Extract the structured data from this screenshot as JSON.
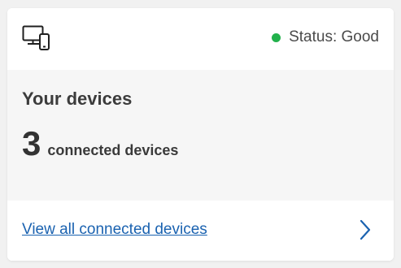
{
  "status": {
    "text": "Status: Good",
    "color": "#22b14c"
  },
  "devices": {
    "title": "Your devices",
    "count": "3",
    "count_label": "connected devices"
  },
  "footer": {
    "link_text": "View all connected devices"
  },
  "icons": {
    "header": "devices-icon",
    "footer": "chevron-right-icon"
  },
  "colors": {
    "link": "#1a62b0",
    "body_background": "#f6f6f6"
  }
}
